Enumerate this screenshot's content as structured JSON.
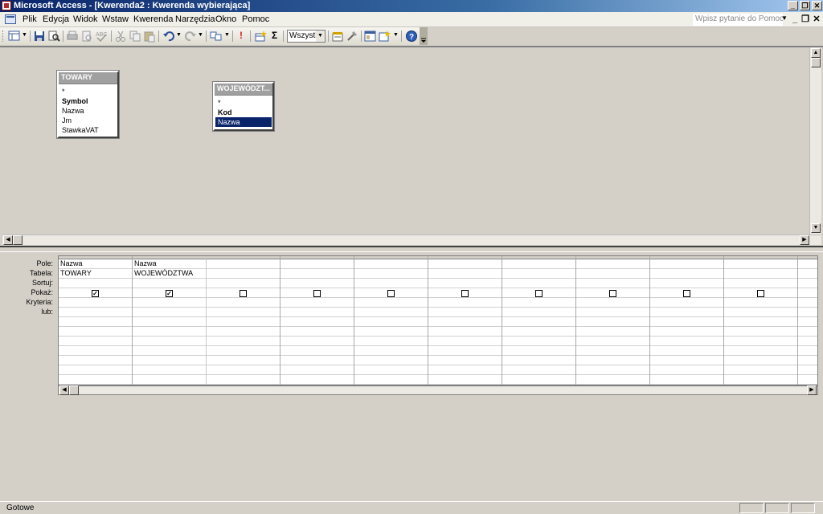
{
  "window": {
    "title": "Microsoft Access - [Kwerenda2 : Kwerenda wybierająca]",
    "controls": [
      "minimize-icon",
      "restore-icon",
      "close-icon"
    ]
  },
  "menu": {
    "items": [
      "Plik",
      "Edycja",
      "Widok",
      "Wstaw",
      "Kwerenda",
      "Narzędzia",
      "Okno",
      "Pomoc"
    ],
    "help_placeholder": "Wpisz pytanie do Pomocy"
  },
  "toolbar": {
    "top_values_combo": "Wszystk",
    "sigma": "Σ",
    "run": "!"
  },
  "tables": [
    {
      "name": "TOWARY",
      "fields": [
        {
          "label": "*",
          "pk": false,
          "selected": false
        },
        {
          "label": "Symbol",
          "pk": true,
          "selected": false
        },
        {
          "label": "Nazwa",
          "pk": false,
          "selected": false
        },
        {
          "label": "Jm",
          "pk": false,
          "selected": false
        },
        {
          "label": "StawkaVAT",
          "pk": false,
          "selected": false
        }
      ]
    },
    {
      "name": "WOJEWÓDZT...",
      "fields": [
        {
          "label": "*",
          "pk": false,
          "selected": false
        },
        {
          "label": "Kod",
          "pk": true,
          "selected": false
        },
        {
          "label": "Nazwa",
          "pk": false,
          "selected": true
        }
      ]
    }
  ],
  "grid": {
    "row_labels": [
      "Pole:",
      "Tabela:",
      "Sortuj:",
      "Pokaż:",
      "Kryteria:",
      "lub:"
    ],
    "columns": [
      {
        "field": "Nazwa",
        "table": "TOWARY",
        "sort": "",
        "show": true
      },
      {
        "field": "Nazwa",
        "table": "WOJEWÓDZTWA",
        "sort": "",
        "show": true
      },
      {
        "field": "",
        "table": "",
        "sort": "",
        "show": false
      },
      {
        "field": "",
        "table": "",
        "sort": "",
        "show": false
      },
      {
        "field": "",
        "table": "",
        "sort": "",
        "show": false
      },
      {
        "field": "",
        "table": "",
        "sort": "",
        "show": false
      },
      {
        "field": "",
        "table": "",
        "sort": "",
        "show": false
      },
      {
        "field": "",
        "table": "",
        "sort": "",
        "show": false
      },
      {
        "field": "",
        "table": "",
        "sort": "",
        "show": false
      },
      {
        "field": "",
        "table": "",
        "sort": "",
        "show": false
      },
      {
        "field": "",
        "table": "",
        "sort": "",
        "show": false
      }
    ]
  },
  "status": {
    "text": "Gotowe"
  }
}
